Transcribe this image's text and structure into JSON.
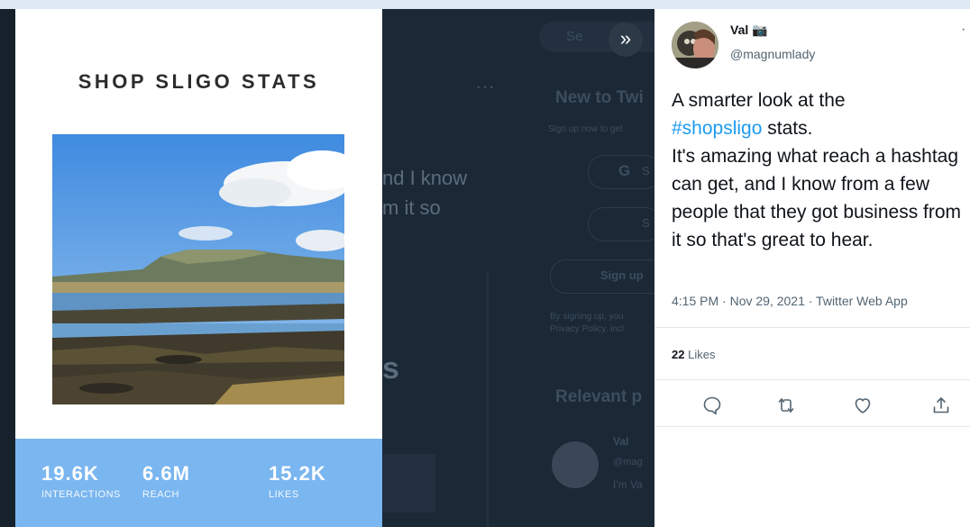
{
  "background_page": {
    "search_placeholder": "Se",
    "new_to_title": "New to Twi",
    "signup_small_text": "Sign up now to get",
    "google_letter": "G",
    "apple_glyph": "",
    "signup_btn_1_text": "S",
    "signup_btn_2_text": "S",
    "signup_button": "Sign up",
    "policy_line_1": "By signing up, you",
    "policy_line_2": "Privacy Policy, incl",
    "relevant_title": "Relevant p",
    "behind_text_1": "nd I know",
    "behind_text_2": "m it so",
    "behind_big": "s",
    "behind_dots": "···",
    "relevant_name": "Val",
    "relevant_handle": "@mag",
    "relevant_snippet": "I'm Va"
  },
  "card": {
    "title": "SHOP SLIGO STATS",
    "stats": [
      {
        "value": "19.6K",
        "label": "INTERACTIONS"
      },
      {
        "value": "6.6M",
        "label": "REACH"
      },
      {
        "value": "15.2K",
        "label": "LIKES"
      }
    ]
  },
  "expand_button": "»",
  "tweet": {
    "author_name": "Val",
    "camera_emoji": "📷",
    "handle": "@magnumlady",
    "more": "·",
    "text_line_1": "A smarter look at the",
    "hashtag": "#shopsligo",
    "text_after_hashtag": " stats.",
    "text_rest": "It's amazing what reach a hashtag can get, and I know from a few people that they got business from it so that's great to hear.",
    "meta": "4:15 PM · Nov 29, 2021 · Twitter Web App",
    "likes_count": "22",
    "likes_label": "Likes"
  },
  "icons": {
    "reply": "reply-icon",
    "retweet": "retweet-icon",
    "like": "heart-icon",
    "share": "share-icon"
  },
  "colors": {
    "accent": "#1d9bf0",
    "stats_band": "#7ab6f0",
    "overlay": "#1b2836"
  }
}
